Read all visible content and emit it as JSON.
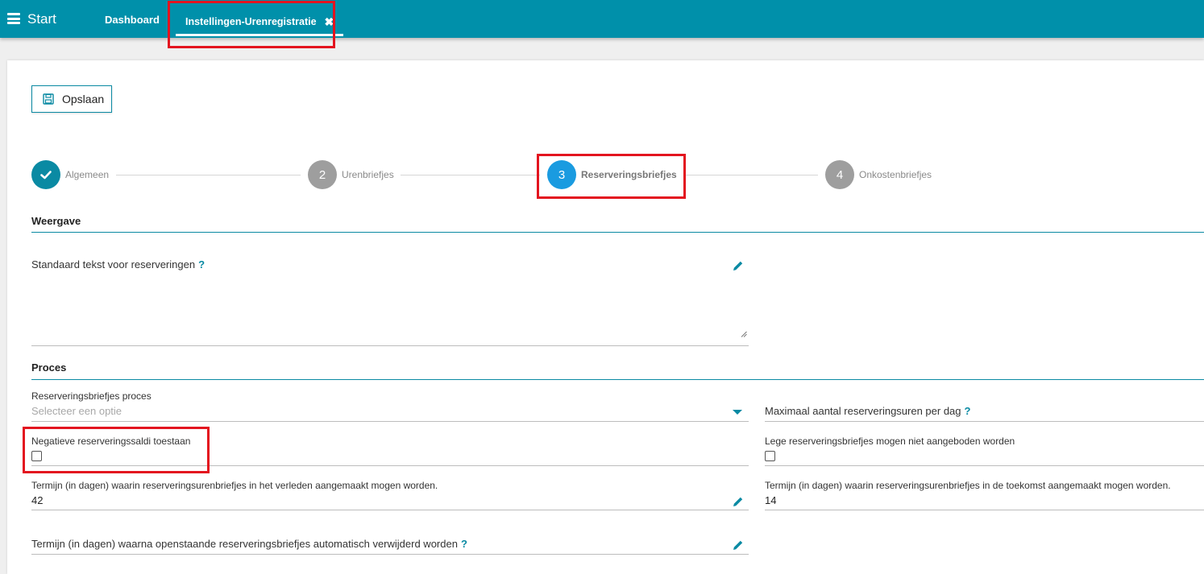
{
  "topbar": {
    "start_label": "Start",
    "tabs": [
      {
        "label": "Dashboard"
      },
      {
        "label": "Instellingen-Urenregistratie",
        "close": "✖"
      }
    ]
  },
  "toolbar": {
    "save_label": "Opslaan"
  },
  "stepper": {
    "steps": [
      {
        "number": "✔",
        "label": "Algemeen",
        "state": "done"
      },
      {
        "number": "2",
        "label": "Urenbriefjes",
        "state": "inactive"
      },
      {
        "number": "3",
        "label": "Reserveringsbriefjes",
        "state": "active"
      },
      {
        "number": "4",
        "label": "Onkostenbriefjes",
        "state": "inactive"
      }
    ]
  },
  "sections": {
    "weergave": {
      "title": "Weergave",
      "standaard_tekst_label": "Standaard tekst voor reserveringen",
      "help": "?"
    },
    "proces": {
      "title": "Proces",
      "proces_label": "Reserveringsbriefjes proces",
      "proces_placeholder": "Selecteer een optie",
      "max_uren_label": "Maximaal aantal reserveringsuren per dag",
      "negatief_label": "Negatieve reserveringssaldi toestaan",
      "lege_label": "Lege reserveringsbriefjes mogen niet aangeboden worden",
      "verleden_label": "Termijn (in dagen) waarin reserveringsurenbriefjes in het verleden aangemaakt mogen worden.",
      "verleden_value": "42",
      "toekomst_label": "Termijn (in dagen) waarin reserveringsurenbriefjes in de toekomst aangemaakt mogen worden.",
      "toekomst_value": "14",
      "verwijderd_label": "Termijn (in dagen) waarna openstaande reserveringsbriefjes automatisch verwijderd worden",
      "help": "?"
    }
  },
  "colors": {
    "topbar": "#0090aa",
    "accent": "#0a8aa3",
    "active_step": "#1a9be0",
    "inactive_step": "#9e9e9e",
    "highlight": "#e3141f"
  }
}
